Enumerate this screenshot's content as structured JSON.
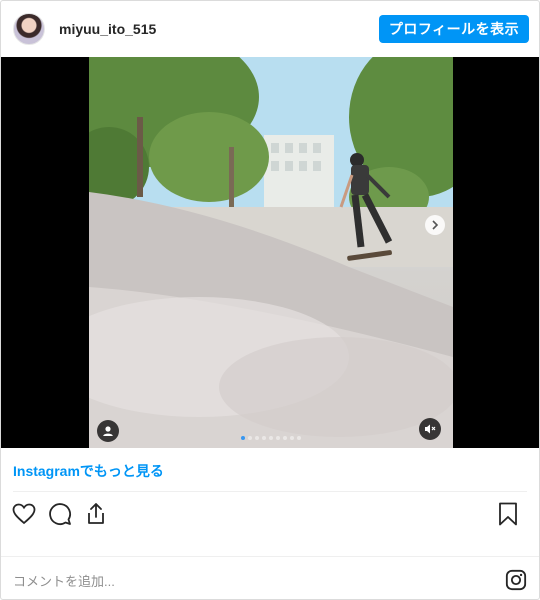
{
  "header": {
    "username": "miyuu_ito_515",
    "profile_button_label": "プロフィールを表示"
  },
  "media": {
    "carousel_dots": 9,
    "active_dot_index": 0,
    "icons": {
      "next": "chevron-right-icon",
      "user_tag": "user-icon",
      "mute": "muted-speaker-icon"
    }
  },
  "footer": {
    "more_link": "Instagramでもっと見る",
    "comment_placeholder": "コメントを追加...",
    "icons": [
      "heart-icon",
      "comment-icon",
      "share-icon",
      "bookmark-icon",
      "instagram-logo-icon"
    ]
  },
  "colors": {
    "accent": "#0095f6",
    "border": "#dbdbdb",
    "text": "#262626",
    "muted": "#8e8e8e"
  }
}
